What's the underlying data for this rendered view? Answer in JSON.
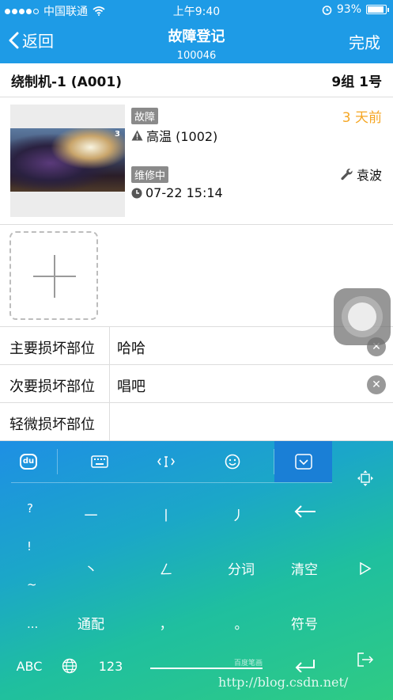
{
  "status_bar": {
    "carrier": "中国联通",
    "time": "上午9:40",
    "battery": "93%",
    "battery_level": 0.93
  },
  "nav": {
    "back_label": "返回",
    "title": "故障登记",
    "subtitle": "100046",
    "done_label": "完成"
  },
  "machine": {
    "name": "绕制机-1 (A001)",
    "location": "9组 1号"
  },
  "fault": {
    "thumb_count": "3",
    "type_tag": "故障",
    "fault_text": "高温 (1002)",
    "ago": "3 天前",
    "status_tag": "维修中",
    "time": "07-22 15:14",
    "repairer": "袁波"
  },
  "form": {
    "rows": [
      {
        "label": "主要损坏部位",
        "value": "哈哈"
      },
      {
        "label": "次要损坏部位",
        "value": "唱吧"
      },
      {
        "label": "轻微损坏部位",
        "value": ""
      }
    ]
  },
  "keyboard": {
    "logo": "du",
    "symbols": [
      "?",
      "!",
      "~",
      "..."
    ],
    "keys": {
      "h": "一",
      "s": "丨",
      "p": "丿",
      "n": "丶",
      "z": "ㄥ",
      "fenci": "分词",
      "qingkong": "清空",
      "tongpei": "通配",
      "comma": "，",
      "period": "。",
      "fuhao": "符号",
      "abc": "ABC",
      "num": "123"
    },
    "brand": "百度笔画"
  },
  "watermark": "http://blog.csdn.net/"
}
